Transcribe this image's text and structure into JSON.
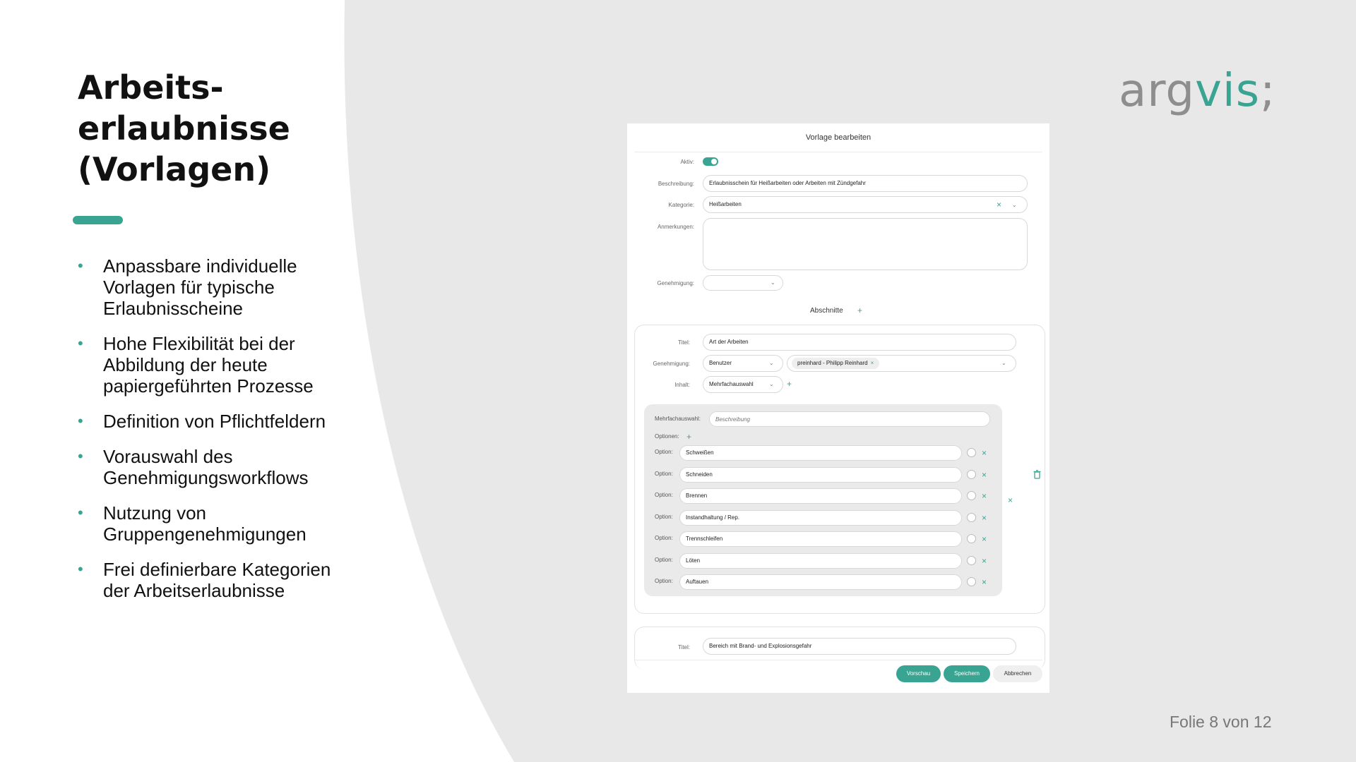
{
  "slide": {
    "title_lines": [
      "Arbeits-",
      "erlaubnisse",
      "(Vorlagen)"
    ],
    "bullets": [
      "Anpassbare individuelle Vorlagen für typische Erlaubnisscheine",
      "Hohe Flexibilität bei der Abbildung der heute papiergeführten Prozesse",
      "Definition von Pflichtfeldern",
      "Vorauswahl des Genehmigungsworkflows",
      "Nutzung von Gruppengenehmigungen",
      "Frei definierbare Kategorien der Arbeitserlaubnisse"
    ],
    "logo": {
      "part1": "arg",
      "part2": "vis",
      "part3": ";"
    },
    "page_number": "Folie 8 von 12",
    "colors": {
      "accent": "#3aa492",
      "background": "#e8e8e8"
    }
  },
  "dialog": {
    "title": "Vorlage bearbeiten",
    "labels": {
      "aktiv": "Aktiv:",
      "beschreibung": "Beschreibung:",
      "kategorie": "Kategorie:",
      "anmerkungen": "Anmerkungen:",
      "genehmigung": "Genehmigung:",
      "abschnitte": "Abschnitte",
      "titel": "Titel:",
      "genehmigung2": "Genehmigung:",
      "inhalt": "Inhalt:",
      "mehrfachauswahl": "Mehrfachauswahl:",
      "optionen": "Optionen:",
      "option": "Option:"
    },
    "values": {
      "beschreibung": "Erlaubnisschein für Heißarbeiten oder Arbeiten mit Zündgefahr",
      "kategorie": "Heißarbeiten",
      "anmerkungen": "",
      "genehmigung": "",
      "section1_titel": "Art der Arbeiten",
      "section1_genehmigung_type": "Benutzer",
      "section1_genehmigung_chip": "preinhard - Philipp Reinhard",
      "section1_inhalt": "Mehrfachauswahl",
      "section2_titel": "Bereich mit Brand- und Explosionsgefahr"
    },
    "placeholders": {
      "mehrfachauswahl": "Beschreibung"
    },
    "options": [
      "Schweißen",
      "Schneiden",
      "Brennen",
      "Instandhaltung / Rep.",
      "Trennschleifen",
      "Löten",
      "Auftauen"
    ],
    "buttons": {
      "vorschau": "Vorschau",
      "speichern": "Speichern",
      "abbrechen": "Abbrechen"
    },
    "icons": [
      "plus-icon",
      "close-icon",
      "chevron-down-icon",
      "trash-icon"
    ]
  }
}
